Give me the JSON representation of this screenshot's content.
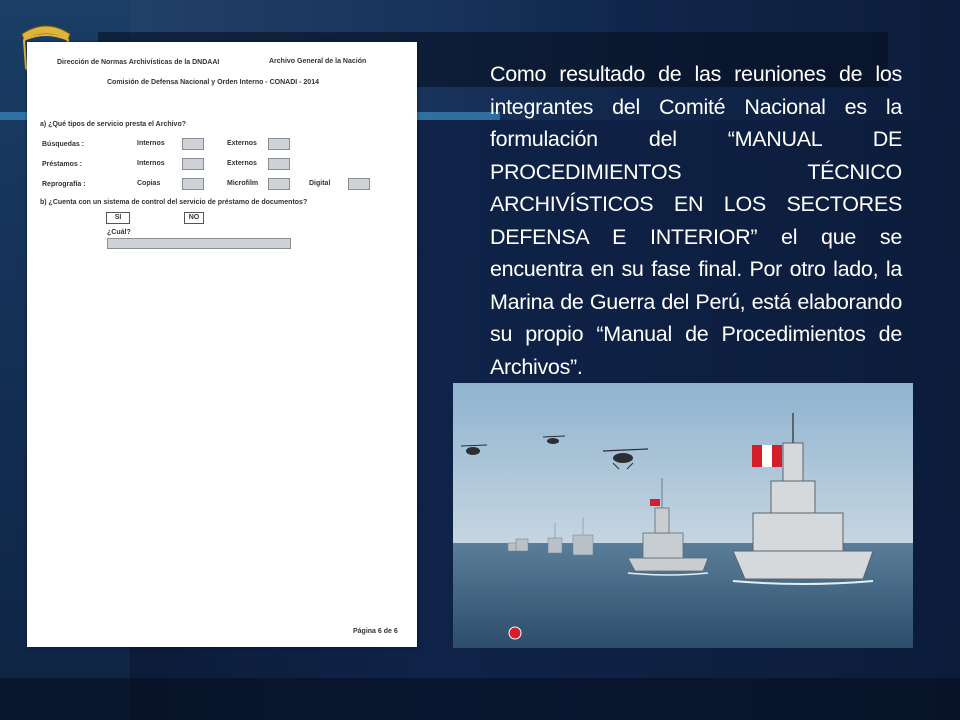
{
  "document": {
    "header_left": "Dirección de Normas Archivísticas de la DNDAAI",
    "header_right": "Archivo General de la Nación",
    "subtitle": "Comisión de Defensa Nacional y Orden Interno - CONADI - 2014",
    "question_a": "a) ¿Qué tipos de servicio presta el Archivo?",
    "rows": [
      {
        "label": "Búsquedas :",
        "opt1": "Internos",
        "opt2": "Externos",
        "opt3": ""
      },
      {
        "label": "Préstamos :",
        "opt1": "Internos",
        "opt2": "Externos",
        "opt3": ""
      },
      {
        "label": "Reprografía :",
        "opt1": "Copias",
        "opt2": "Microfilm",
        "opt3": "Digital"
      }
    ],
    "question_b": "b) ¿Cuenta con un sistema de control del servicio de  préstamo de documentos?",
    "yes": "SI",
    "no": "NO",
    "which": "¿Cuál?",
    "page": "Página  6  de  6"
  },
  "body_text": "Como resultado de  las reuniones de los integrantes del Comité Nacional es la formulación del “MANUAL DE PROCEDIMIENTOS TÉCNICO ARCHIVÍSTICOS EN LOS SECTORES DEFENSA E INTERIOR” el que se encuentra en su fase final. Por otro lado, la Marina de Guerra del Perú, está elaborando su propio “Manual de Procedimientos de Archivos”.",
  "colors": {
    "background": "#0f2348",
    "accent_stripe": "#3a83b8",
    "text": "#ffffff",
    "flag_red": "#d21f2b"
  },
  "icons": {
    "crest": "navy-crest-icon",
    "photo": "naval-fleet-photo"
  }
}
